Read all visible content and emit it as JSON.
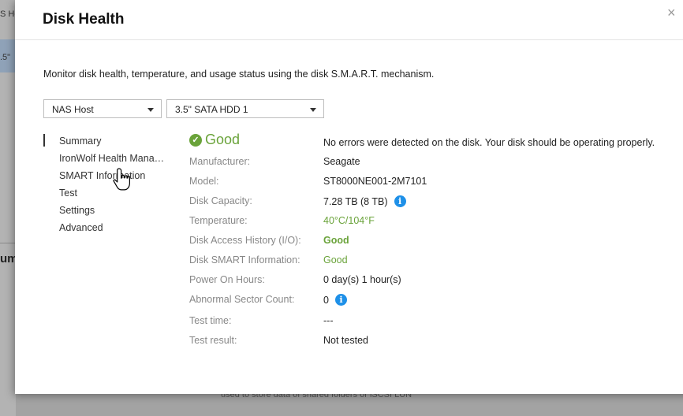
{
  "background": {
    "sidebar_fragment_top": "S Ho",
    "sidebar_fragment_sel": ".5\"",
    "fragment_big": "um",
    "bottom_text": "used to store data of shared folders or iSCSI LUN"
  },
  "modal": {
    "title": "Disk Health",
    "close_label": "×",
    "description": "Monitor disk health, temperature, and usage status using the disk S.M.A.R.T. mechanism.",
    "host_select": "NAS Host",
    "disk_select": "3.5\" SATA HDD 1"
  },
  "nav": {
    "items": [
      {
        "label": "Summary",
        "active": true
      },
      {
        "label": "IronWolf Health Management",
        "active": false
      },
      {
        "label": "SMART Information",
        "active": false
      },
      {
        "label": "Test",
        "active": false
      },
      {
        "label": "Settings",
        "active": false
      },
      {
        "label": "Advanced",
        "active": false
      }
    ]
  },
  "summary": {
    "status": "Good",
    "status_message": "No errors were detected on the disk. Your disk should be operating properly.",
    "rows": [
      {
        "label": "Manufacturer:",
        "value": "Seagate"
      },
      {
        "label": "Model:",
        "value": "ST8000NE001-2M7101"
      },
      {
        "label": "Disk Capacity:",
        "value": "7.28 TB (8 TB)",
        "info": true
      },
      {
        "label": "Temperature:",
        "value": "40°C/104°F",
        "style": "green"
      },
      {
        "label": "Disk Access History (I/O):",
        "value": "Good",
        "style": "green-bold"
      },
      {
        "label": "Disk SMART Information:",
        "value": "Good",
        "style": "green"
      },
      {
        "label": "Power On Hours:",
        "value": "0 day(s) 1 hour(s)"
      },
      {
        "label": "Abnormal Sector Count:",
        "value": "0",
        "info": true
      },
      {
        "label": "Test time:",
        "value": "---"
      },
      {
        "label": "Test result:",
        "value": "Not tested"
      }
    ]
  },
  "colors": {
    "good_green": "#6aa33a",
    "info_blue": "#1e90e8"
  }
}
